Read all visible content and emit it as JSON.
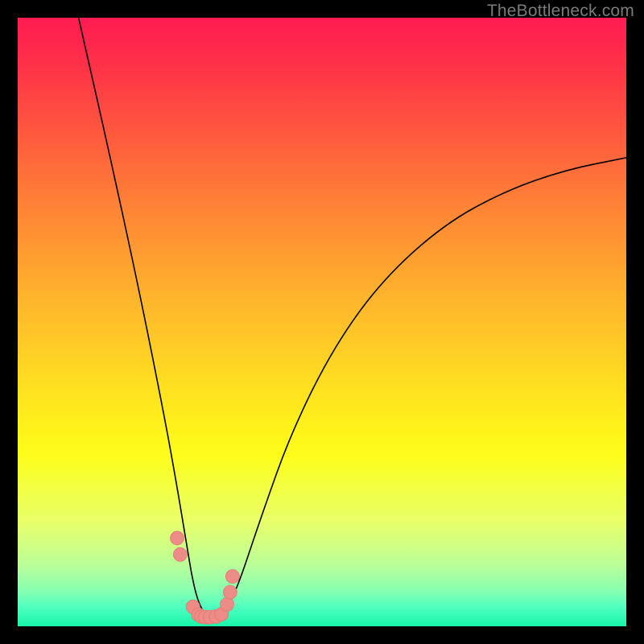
{
  "watermark": "TheBottleneck.com",
  "chart_data": {
    "type": "line",
    "title": "",
    "xlabel": "",
    "ylabel": "",
    "xlim": [
      0,
      100
    ],
    "ylim": [
      0,
      100
    ],
    "grid": false,
    "series": [
      {
        "name": "bottleneck-curve",
        "x": [
          10,
          15,
          20,
          24,
          26,
          27.5,
          29,
          30.5,
          32.5,
          34,
          36,
          40,
          45,
          52,
          60,
          70,
          80,
          90,
          100
        ],
        "y": [
          100,
          78,
          55,
          35,
          24,
          15,
          6,
          2,
          1.5,
          2.5,
          6,
          18,
          32,
          46,
          57,
          66,
          71.5,
          75,
          77
        ]
      }
    ],
    "markers": {
      "name": "bottleneck-points",
      "x": [
        26.2,
        26.7,
        28.8,
        29.7,
        30.2,
        30.8,
        31.6,
        32.6,
        33.5,
        34.4,
        34.9,
        35.3
      ],
      "y": [
        14.5,
        11.8,
        3.2,
        1.9,
        1.6,
        1.5,
        1.5,
        1.6,
        2.0,
        3.6,
        5.6,
        8.2
      ]
    }
  }
}
